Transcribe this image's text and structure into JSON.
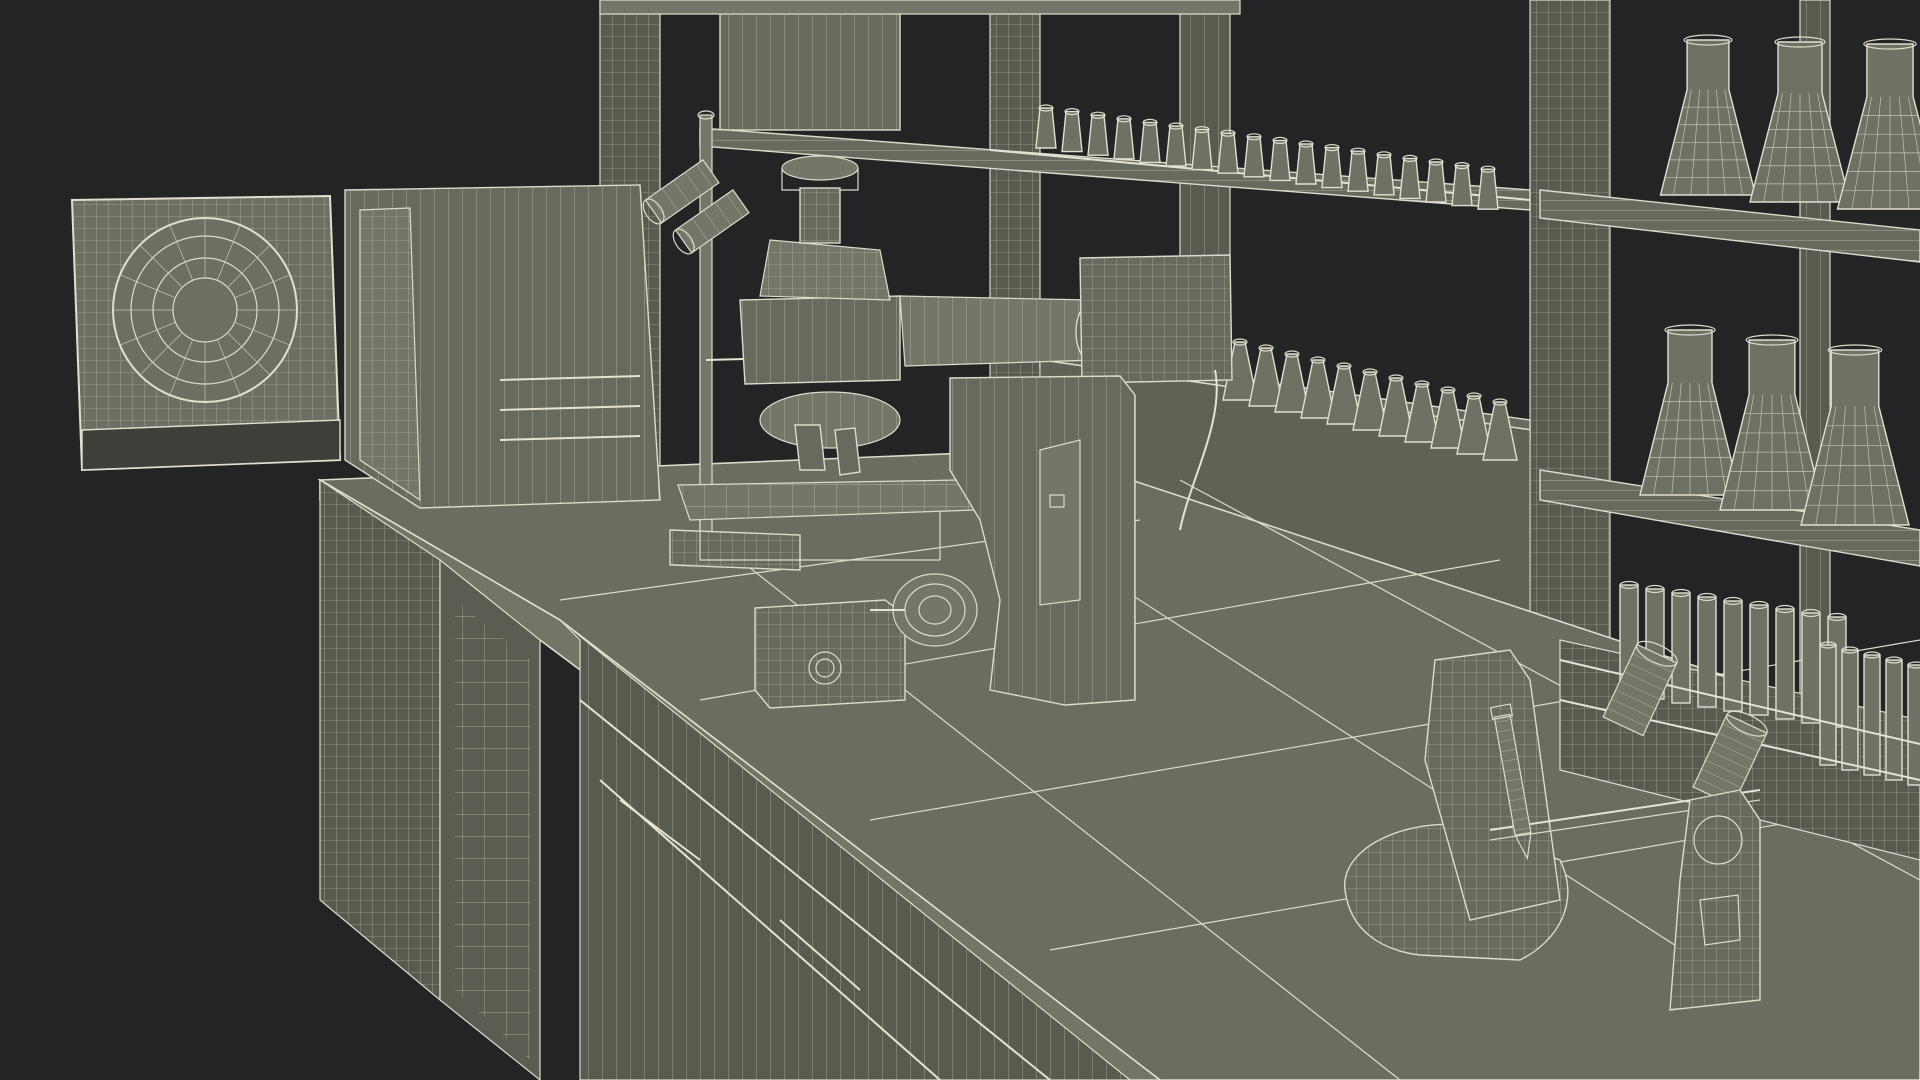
{
  "scene": {
    "subject": "",
    "background_color": "#232425",
    "surface_color": "#6a6e61",
    "wire_color": "#dcdccb"
  }
}
